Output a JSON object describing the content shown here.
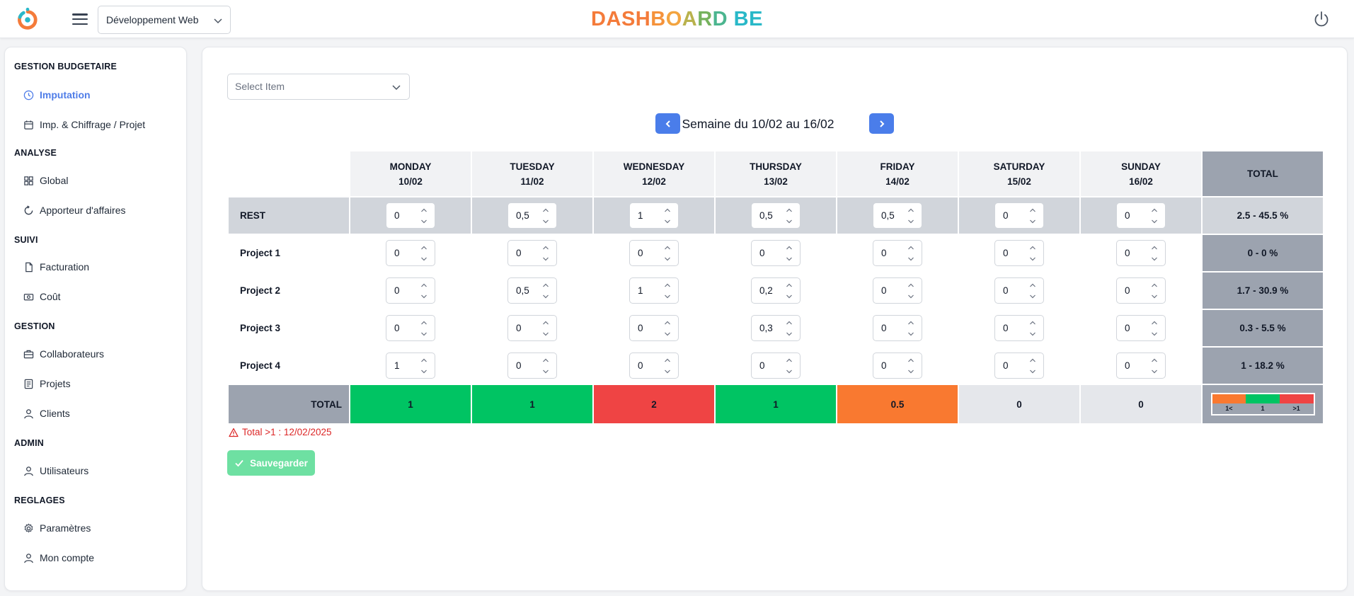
{
  "header": {
    "workspace": "Développement Web",
    "brand": [
      "D",
      "A",
      "S",
      "H",
      "B",
      "O",
      "A",
      "R",
      "D",
      " ",
      "B",
      "E"
    ],
    "brand_colors": [
      "#f47b3a",
      "#f47b3a",
      "#f47b3a",
      "#f47b3a",
      "#f5923a",
      "#f3a43f",
      "#b9b24d",
      "#76b25e",
      "#4bb58f",
      " ",
      "#29b8c8",
      "#29b8c8"
    ]
  },
  "sidebar": {
    "sections": [
      {
        "title": "GESTION BUDGETAIRE",
        "items": [
          {
            "label": "Imputation",
            "icon": "clock-icon",
            "active": true
          },
          {
            "label": "Imp. & Chiffrage / Projet",
            "icon": "calendar-icon"
          }
        ]
      },
      {
        "title": "ANALYSE",
        "items": [
          {
            "label": "Global",
            "icon": "grid-icon"
          },
          {
            "label": "Apporteur d'affaires",
            "icon": "refresh-icon"
          }
        ]
      },
      {
        "title": "SUIVI",
        "items": [
          {
            "label": "Facturation",
            "icon": "file-icon"
          },
          {
            "label": "Coût",
            "icon": "banknote-icon"
          }
        ]
      },
      {
        "title": "GESTION",
        "items": [
          {
            "label": "Collaborateurs",
            "icon": "briefcase-icon"
          },
          {
            "label": "Projets",
            "icon": "list-icon"
          },
          {
            "label": "Clients",
            "icon": "user-icon"
          }
        ]
      },
      {
        "title": "ADMIN",
        "items": [
          {
            "label": "Utilisateurs",
            "icon": "user-icon"
          }
        ]
      },
      {
        "title": "REGLAGES",
        "items": [
          {
            "label": "Paramètres",
            "icon": "gear-icon"
          },
          {
            "label": "Mon compte",
            "icon": "user-icon"
          }
        ]
      }
    ]
  },
  "main": {
    "item_select_placeholder": "Select Item",
    "week_label": "Semaine du 10/02 au 16/02",
    "days": [
      {
        "name": "MONDAY",
        "date": "10/02"
      },
      {
        "name": "TUESDAY",
        "date": "11/02"
      },
      {
        "name": "WEDNESDAY",
        "date": "12/02"
      },
      {
        "name": "THURSDAY",
        "date": "13/02"
      },
      {
        "name": "FRIDAY",
        "date": "14/02"
      },
      {
        "name": "SATURDAY",
        "date": "15/02"
      },
      {
        "name": "SUNDAY",
        "date": "16/02"
      }
    ],
    "total_header": "TOTAL",
    "rows": [
      {
        "label": "REST",
        "values": [
          "0",
          "0,5",
          "1",
          "0,5",
          "0,5",
          "0",
          "0"
        ],
        "total": "2.5 - 45.5 %"
      },
      {
        "label": "Project 1",
        "values": [
          "0",
          "0",
          "0",
          "0",
          "0",
          "0",
          "0"
        ],
        "total": "0 - 0 %"
      },
      {
        "label": "Project 2",
        "values": [
          "0",
          "0,5",
          "1",
          "0,2",
          "0",
          "0",
          "0"
        ],
        "total": "1.7 - 30.9 %"
      },
      {
        "label": "Project 3",
        "values": [
          "0",
          "0",
          "0",
          "0,3",
          "0",
          "0",
          "0"
        ],
        "total": "0.3 - 5.5 %"
      },
      {
        "label": "Project 4",
        "values": [
          "1",
          "0",
          "0",
          "0",
          "0",
          "0",
          "0"
        ],
        "total": "1 - 18.2 %"
      }
    ],
    "total_row": {
      "label": "TOTAL",
      "values": [
        "1",
        "1",
        "2",
        "1",
        "0.5",
        "0",
        "0"
      ],
      "status": [
        "ok",
        "ok",
        "over",
        "ok",
        "under",
        "empty",
        "empty"
      ]
    },
    "legend": {
      "labels": [
        "1<",
        "1",
        ">1"
      ],
      "colors": [
        "#f97930",
        "#00c463",
        "#ef4444"
      ]
    },
    "warning": "Total >1 : 12/02/2025",
    "save_label": "Sauvegarder"
  },
  "colors": {
    "accent": "#4a7dea",
    "ok": "#00c463",
    "over": "#ef4444",
    "under": "#f97930",
    "empty": "#e5e7eb",
    "save": "#6ee0a2"
  }
}
